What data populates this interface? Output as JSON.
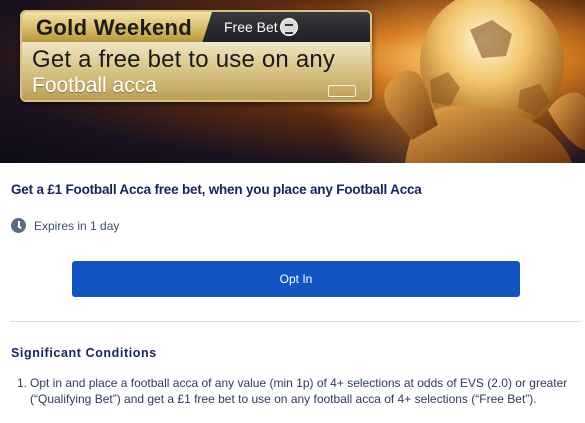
{
  "banner": {
    "tag": "Gold Weekend",
    "free_bet_label": "Free Bet",
    "line1": "Get a free bet to use on any",
    "line2": "Football acca",
    "icons": {
      "bet": "free-bet-icon",
      "brand": "brand-logo-icon"
    }
  },
  "offer": {
    "headline": "Get a £1 Football Acca free bet, when you place any Football Acca",
    "expiry": "Expires in 1 day",
    "expiry_icon": "clock-icon",
    "optin_label": "Opt In"
  },
  "conditions": {
    "title": "Significant Conditions",
    "items": [
      {
        "number": "1.",
        "text": "Opt in and place a football acca of any value (min 1p) of 4+ selections at odds of EVS (2.0) or greater (“Qualifying Bet”) and get a £1 free bet to use on any football acca of 4+ selections (“Free Bet”)."
      }
    ]
  },
  "colors": {
    "accent_button": "#1155c2",
    "heading_text": "#17235a",
    "gold": "#d9bb6a"
  }
}
